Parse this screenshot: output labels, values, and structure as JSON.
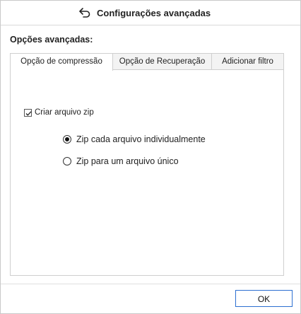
{
  "window": {
    "title": "Configurações avançadas",
    "back_icon": "back-arrow-icon"
  },
  "section": {
    "label": "Opções avançadas:"
  },
  "tabs": [
    {
      "label": "Opção de compressão",
      "active": true
    },
    {
      "label": "Opção de Recuperação",
      "active": false
    },
    {
      "label": "Adicionar filtro",
      "active": false
    }
  ],
  "compression": {
    "create_zip_label": "Criar arquivo zip",
    "create_zip_checked": true,
    "options": [
      {
        "label": "Zip cada arquivo individualmente",
        "selected": true
      },
      {
        "label": "Zip para um arquivo único",
        "selected": false
      }
    ]
  },
  "footer": {
    "ok_label": "OK"
  },
  "colors": {
    "accent_border": "#2c6fd1"
  }
}
